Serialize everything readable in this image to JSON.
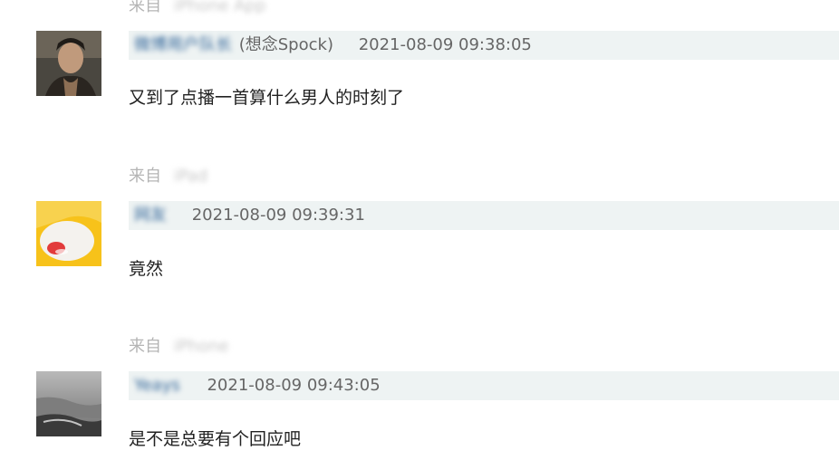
{
  "comments": [
    {
      "from_label": "来自",
      "from_source": "iPhone App",
      "author": "微博用户队长",
      "author_alias": "(想念Spock)",
      "time": "2021-08-09 09:38:05",
      "text": "又到了点播一首算什么男人的时刻了"
    },
    {
      "from_label": "来自",
      "from_source": "iPad",
      "author": "网友",
      "author_alias": "",
      "time": "2021-08-09 09:39:31",
      "text": "竟然"
    },
    {
      "from_label": "来自",
      "from_source": "iPhone",
      "author": "Yeays",
      "author_alias": "",
      "time": "2021-08-09 09:43:05",
      "text": "是不是总要有个回应吧"
    }
  ]
}
